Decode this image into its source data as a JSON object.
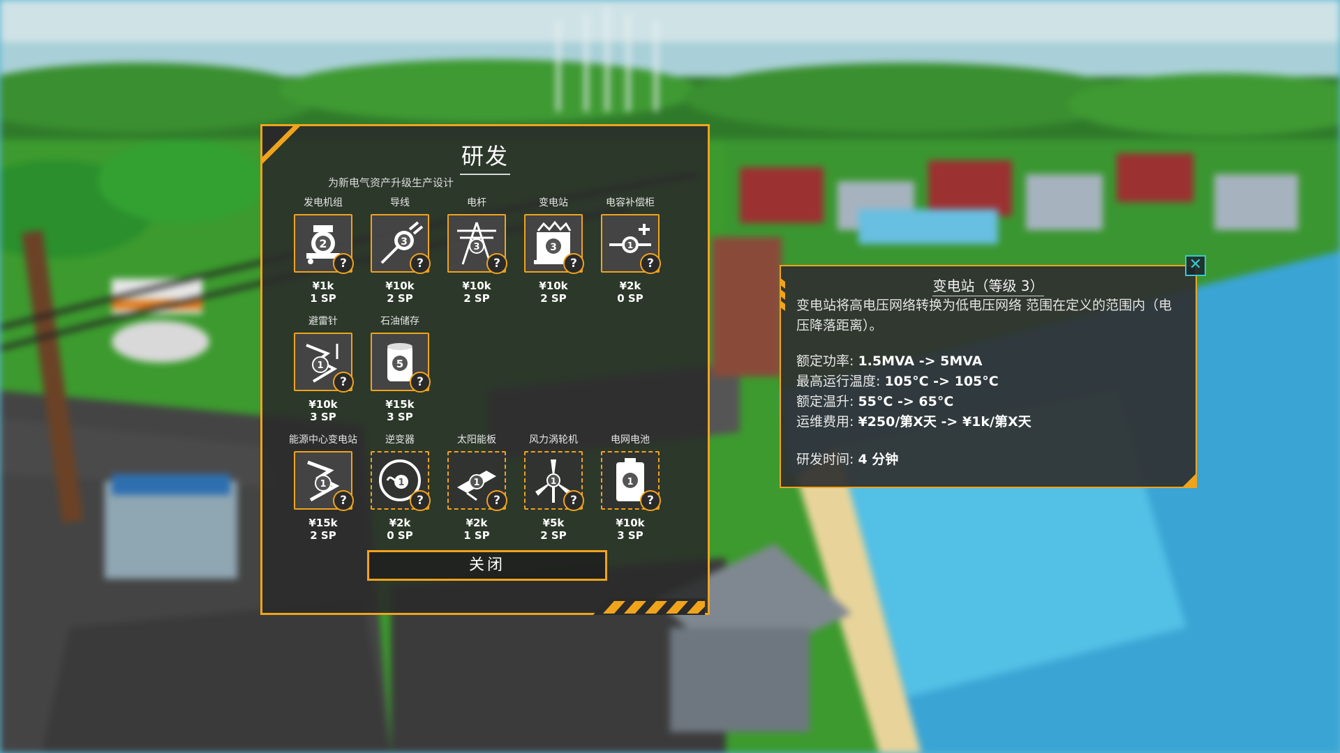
{
  "research": {
    "title": "研发",
    "subtitle": "为新电气资产升级生产设计",
    "close_label": "关闭",
    "rows": [
      [
        {
          "label": "发电机组",
          "cost": "¥1k",
          "sp": "1 SP",
          "level": "2",
          "icon": "generator-icon",
          "locked": false
        },
        {
          "label": "导线",
          "cost": "¥10k",
          "sp": "2 SP",
          "level": "3",
          "icon": "wire-icon",
          "locked": false
        },
        {
          "label": "电杆",
          "cost": "¥10k",
          "sp": "2 SP",
          "level": "3",
          "icon": "pylon-icon",
          "locked": false
        },
        {
          "label": "变电站",
          "cost": "¥10k",
          "sp": "2 SP",
          "level": "3",
          "icon": "substation-icon",
          "locked": false
        },
        {
          "label": "电容补偿柜",
          "cost": "¥2k",
          "sp": "0 SP",
          "level": "1",
          "icon": "capacitor-icon",
          "locked": false
        }
      ],
      [
        {
          "label": "避雷针",
          "cost": "¥10k",
          "sp": "3 SP",
          "level": "1",
          "icon": "lightning-rod-icon",
          "locked": false
        },
        {
          "label": "石油储存",
          "cost": "¥15k",
          "sp": "3 SP",
          "level": "5",
          "icon": "oil-storage-icon",
          "locked": false
        }
      ],
      [
        {
          "label": "能源中心变电站",
          "cost": "¥15k",
          "sp": "2 SP",
          "level": "1",
          "icon": "energy-hub-icon",
          "locked": false
        },
        {
          "label": "逆变器",
          "cost": "¥2k",
          "sp": "0 SP",
          "level": "1",
          "icon": "inverter-icon",
          "locked": true
        },
        {
          "label": "太阳能板",
          "cost": "¥2k",
          "sp": "1 SP",
          "level": "1",
          "icon": "solar-panel-icon",
          "locked": true
        },
        {
          "label": "风力涡轮机",
          "cost": "¥5k",
          "sp": "2 SP",
          "level": "1",
          "icon": "wind-turbine-icon",
          "locked": true
        },
        {
          "label": "电网电池",
          "cost": "¥10k",
          "sp": "3 SP",
          "level": "1",
          "icon": "grid-battery-icon",
          "locked": true
        }
      ]
    ]
  },
  "tooltip": {
    "title": "变电站（等级 3）",
    "description": "变电站将高电压网络转换为低电压网络 范围在定义的范围内（电压降落距离）。",
    "stats": [
      {
        "label": "额定功率: ",
        "value": "1.5MVA -> 5MVA"
      },
      {
        "label": "最高运行温度: ",
        "value": "105°C -> 105°C"
      },
      {
        "label": "额定温升: ",
        "value": "55°C -> 65°C"
      },
      {
        "label": "运维费用: ",
        "value": "¥250/第X天 -> ¥1k/第X天"
      }
    ],
    "research_time_label": "研发时间: ",
    "research_time_value": "4 分钟",
    "close_symbol": "✕"
  },
  "badge_symbol": "?",
  "colors": {
    "accent": "#f0a41c",
    "panel": "#2a2a2a",
    "close_accent": "#39c8d0"
  }
}
